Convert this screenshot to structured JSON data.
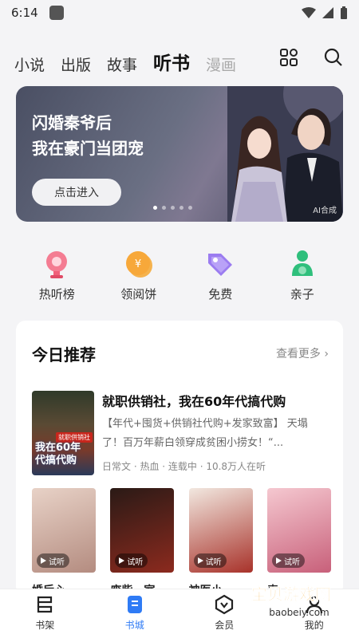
{
  "status": {
    "time": "6:14"
  },
  "tabs": [
    {
      "label": "小说",
      "state": "normal"
    },
    {
      "label": "出版",
      "state": "normal"
    },
    {
      "label": "故事",
      "state": "normal"
    },
    {
      "label": "听书",
      "state": "active"
    },
    {
      "label": "漫画",
      "state": "faded"
    }
  ],
  "top_icons": [
    "grid-icon",
    "search-icon"
  ],
  "banner": {
    "title_line1": "闪婚秦爷后",
    "title_line2": "我在豪门当团宠",
    "button": "点击进入",
    "ai_tag": "AI合成",
    "dots": 5,
    "active_dot": 0
  },
  "quick_entries": [
    {
      "label": "热听榜",
      "icon": "trophy-icon",
      "color": "#f0607a"
    },
    {
      "label": "领阅饼",
      "icon": "coin-icon",
      "color": "#f7a83a"
    },
    {
      "label": "免费",
      "icon": "tag-icon",
      "color": "#9b7cf0"
    },
    {
      "label": "亲子",
      "icon": "family-icon",
      "color": "#2fbf7c"
    }
  ],
  "recommend": {
    "title": "今日推荐",
    "more": "查看更多 ›",
    "feature": {
      "title": "就职供销社，我在60年代搞代购",
      "desc": "【年代+囤货+供销社代购+发家致富】 天塌了！百万年薪白领穿成贫困小捞女！“...",
      "meta": "日常文 · 热血 · 连载中 · 10.8万人在听",
      "cover_text": "我在60年代搞代购",
      "cover_badge": "就职供销社"
    },
    "books": [
      {
        "title": "婚后心",
        "trial": "试听",
        "colors": [
          "#e8d2c7",
          "#b48c80"
        ]
      },
      {
        "title": "废柴…室",
        "trial": "试听",
        "colors": [
          "#2a1a16",
          "#8c2a1e"
        ]
      },
      {
        "title": "神医小…",
        "trial": "试听",
        "colors": [
          "#f2e8e0",
          "#a8322a"
        ]
      },
      {
        "title": "表… …",
        "trial": "试听",
        "colors": [
          "#f5c8d0",
          "#c8607a"
        ]
      }
    ]
  },
  "bottom_nav": [
    {
      "label": "书架",
      "icon": "bookshelf-icon",
      "active": false
    },
    {
      "label": "书城",
      "icon": "bookstore-icon",
      "active": true
    },
    {
      "label": "会员",
      "icon": "vip-icon",
      "active": false
    },
    {
      "label": "我的",
      "icon": "profile-icon",
      "active": false
    }
  ],
  "colors": {
    "accent": "#2f7bf5",
    "background": "#f4f4f6"
  },
  "watermark": {
    "text": "宝贝游戏网",
    "url_text": "baobeiy.com"
  }
}
